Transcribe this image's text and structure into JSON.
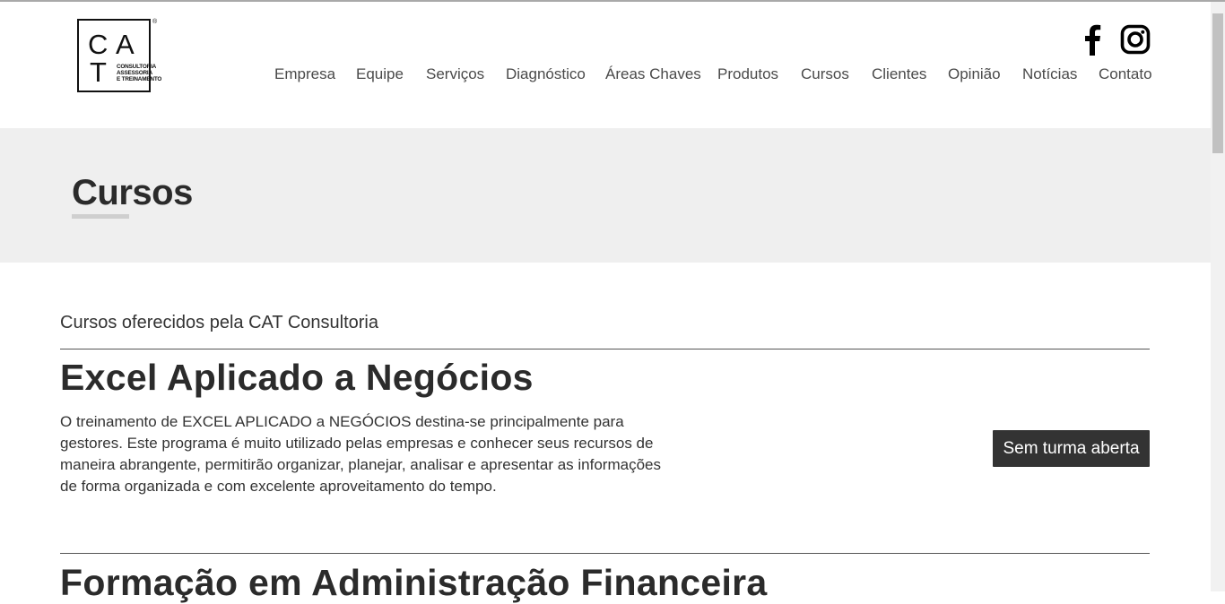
{
  "logo": {
    "letters": [
      "C",
      "A",
      "T"
    ],
    "registered": "®",
    "tagline": [
      "CONSULTORIA",
      "ASSESSORIA",
      "E TREINAMENTO"
    ]
  },
  "social": {
    "facebook_icon": "facebook-icon",
    "instagram_icon": "instagram-icon"
  },
  "nav": {
    "items": [
      {
        "label": "Empresa"
      },
      {
        "label": "Equipe"
      },
      {
        "label": "Serviços"
      },
      {
        "label": "Diagnóstico"
      },
      {
        "label": "Áreas Chaves"
      },
      {
        "label": "Produtos"
      },
      {
        "label": "Cursos"
      },
      {
        "label": "Clientes"
      },
      {
        "label": "Opinião"
      },
      {
        "label": "Notícias"
      },
      {
        "label": "Contato"
      }
    ]
  },
  "banner": {
    "title": "Cursos"
  },
  "main": {
    "intro": "Cursos oferecidos pela CAT Consultoria",
    "courses": [
      {
        "title": "Excel Aplicado a Negócios",
        "description": "O treinamento de EXCEL APLICADO a NEGÓCIOS destina-se principalmente para gestores. Este programa é muito utilizado pelas empresas e conhecer seus recursos de maneira abrangente, permitirão organizar, planejar, analisar e apresentar as informações de forma organizada e com excelente aproveitamento do tempo.",
        "button_label": "Sem turma aberta"
      },
      {
        "title": "Formação em Administração Financeira"
      }
    ]
  },
  "colors": {
    "text": "#333333",
    "banner_bg": "#efefef",
    "button_bg": "#333333",
    "button_text": "#ffffff"
  }
}
